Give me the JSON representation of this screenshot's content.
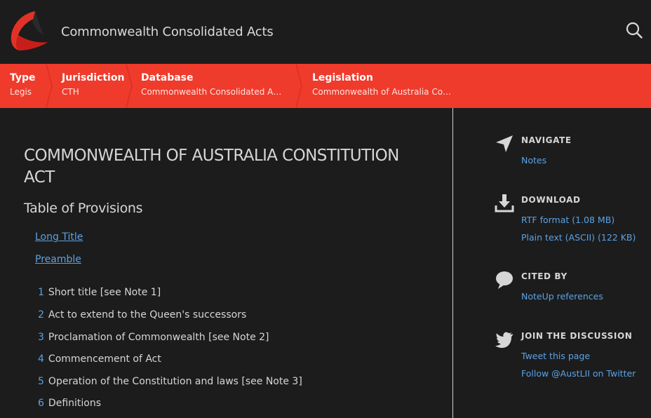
{
  "header": {
    "site_title": "Commonwealth Consolidated Acts",
    "logo": "austlii-logo",
    "search_icon": "search-icon"
  },
  "breadcrumbs": [
    {
      "key": "Type",
      "value": "Legis"
    },
    {
      "key": "Jurisdiction",
      "value": "CTH"
    },
    {
      "key": "Database",
      "value": "Commonwealth Consolidated A…"
    },
    {
      "key": "Legislation",
      "value": "Commonwealth of Australia Co…"
    }
  ],
  "main": {
    "title": "COMMONWEALTH OF AUSTRALIA CONSTITUTION ACT",
    "toc_heading": "Table of Provisions",
    "links": [
      "Long Title",
      "Preamble"
    ],
    "provisions": [
      {
        "num": "1",
        "text": "Short title [see Note 1]"
      },
      {
        "num": "2",
        "text": "Act to extend to the Queen's successors"
      },
      {
        "num": "3",
        "text": "Proclamation of Commonwealth [see Note 2]"
      },
      {
        "num": "4",
        "text": "Commencement of Act"
      },
      {
        "num": "5",
        "text": "Operation of the Constitution and laws [see Note 3]"
      },
      {
        "num": "6",
        "text": "Definitions"
      }
    ]
  },
  "sidebar": {
    "navigate": {
      "heading": "NAVIGATE",
      "icon": "navigate-arrow-icon",
      "links": [
        "Notes"
      ]
    },
    "download": {
      "heading": "DOWNLOAD",
      "icon": "download-icon",
      "links": [
        "RTF format (1.08 MB)",
        "Plain text (ASCII) (122 KB)"
      ]
    },
    "cited_by": {
      "heading": "CITED BY",
      "icon": "speech-bubble-icon",
      "links": [
        "NoteUp references"
      ]
    },
    "discussion": {
      "heading": "JOIN THE DISCUSSION",
      "icon": "twitter-bird-icon",
      "links": [
        "Tweet this page",
        "Follow @AustLII on Twitter"
      ]
    }
  },
  "colors": {
    "background": "#1c1c1c",
    "accent_red": "#ef3b2c",
    "link_blue": "#5aa2e6",
    "text": "#d6d6d6"
  }
}
